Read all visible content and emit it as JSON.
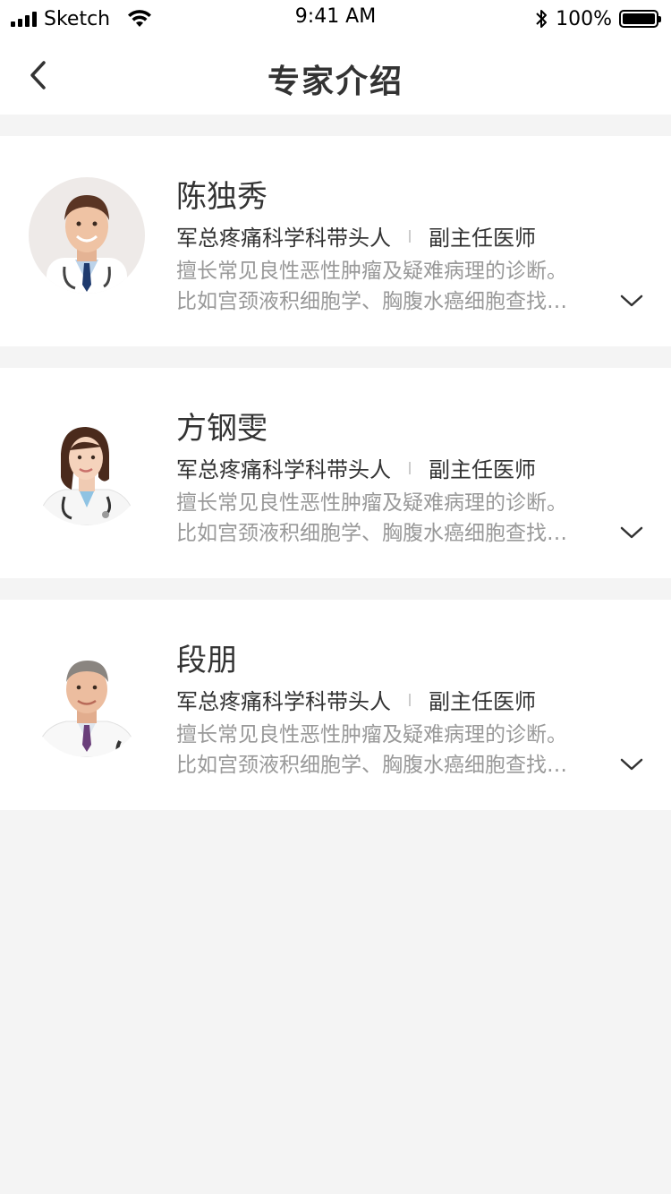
{
  "status_bar": {
    "carrier": "Sketch",
    "time": "9:41 AM",
    "battery_percent": "100%",
    "battery_level": 1.0
  },
  "navbar": {
    "title": "专家介绍"
  },
  "experts": [
    {
      "name": "陈独秀",
      "department": "军总疼痛科学科带头人",
      "title": "副主任医师",
      "desc_line1": "擅长常见良性恶性肿瘤及疑难病理的诊断。",
      "desc_line2": "比如宫颈液积细胞学、胸腹水癌细胞查找…"
    },
    {
      "name": "方钢雯",
      "department": "军总疼痛科学科带头人",
      "title": "副主任医师",
      "desc_line1": "擅长常见良性恶性肿瘤及疑难病理的诊断。",
      "desc_line2": "比如宫颈液积细胞学、胸腹水癌细胞查找…"
    },
    {
      "name": "段朋",
      "department": "军总疼痛科学科带头人",
      "title": "副主任医师",
      "desc_line1": "擅长常见良性恶性肿瘤及疑难病理的诊断。",
      "desc_line2": "比如宫颈液积细胞学、胸腹水癌细胞查找…"
    }
  ],
  "icons": {
    "back": "chevron-left-icon",
    "expand": "chevron-down-icon",
    "wifi": "wifi-icon",
    "bluetooth": "bluetooth-icon",
    "battery": "battery-icon",
    "signal": "signal-icon"
  }
}
